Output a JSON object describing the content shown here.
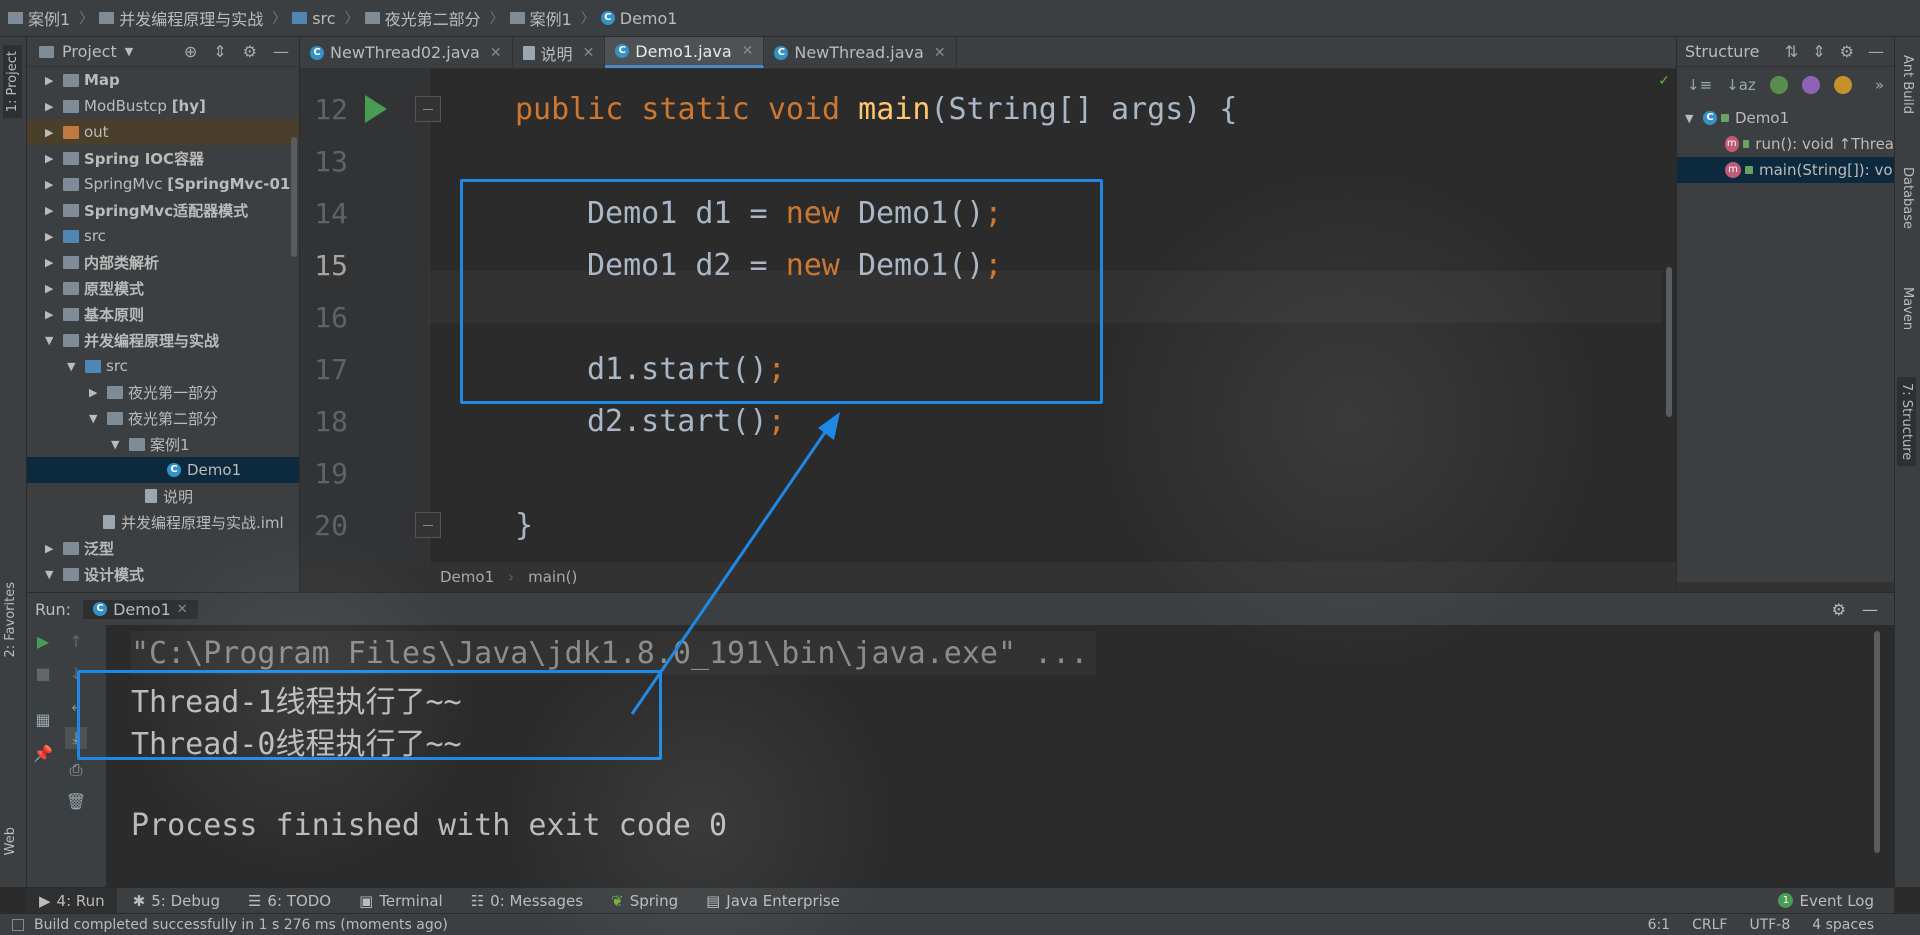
{
  "breadcrumb": [
    "案例1",
    "并发编程原理与实战",
    "src",
    "夜光第二部分",
    "案例1",
    "Demo1"
  ],
  "left_tabs": {
    "project": "1: Project",
    "favorites": "2: Favorites",
    "web": "Web"
  },
  "right_tabs": {
    "ant": "Ant Build",
    "database": "Database",
    "maven": "Maven",
    "structure": "7: Structure"
  },
  "project_panel": {
    "title": "Project",
    "tree": [
      {
        "label": "Map",
        "bold": true
      },
      {
        "label": "ModBustcp",
        "suffix": "[hy]"
      },
      {
        "label": "out"
      },
      {
        "label": "Spring IOC容器",
        "bold": true
      },
      {
        "label": "SpringMvc",
        "suffix": "[SpringMvc-01]"
      },
      {
        "label": "SpringMvc适配器模式",
        "bold": true
      },
      {
        "label": "src"
      },
      {
        "label": "内部类解析",
        "bold": true
      },
      {
        "label": "原型模式",
        "bold": true
      },
      {
        "label": "基本原则",
        "bold": true
      },
      {
        "label": "并发编程原理与实战",
        "bold": true
      },
      {
        "label": "src"
      },
      {
        "label": "夜光第一部分"
      },
      {
        "label": "夜光第二部分"
      },
      {
        "label": "案例1"
      },
      {
        "label": "Demo1"
      },
      {
        "label": "说明"
      },
      {
        "label": "并发编程原理与实战.iml"
      },
      {
        "label": "泛型",
        "bold": true
      },
      {
        "label": "设计模式",
        "bold": true
      }
    ]
  },
  "editor": {
    "tabs": [
      {
        "label": "NewThread02.java"
      },
      {
        "label": "说明"
      },
      {
        "label": "Demo1.java"
      },
      {
        "label": "NewThread.java"
      }
    ],
    "lines": [
      {
        "n": "12"
      },
      {
        "n": "13"
      },
      {
        "n": "14"
      },
      {
        "n": "15"
      },
      {
        "n": "16"
      },
      {
        "n": "17"
      },
      {
        "n": "18"
      },
      {
        "n": "19"
      },
      {
        "n": "20"
      }
    ],
    "code": {
      "l12_a": "public static void ",
      "l12_b": "main",
      "l12_c": "(String[] args) {",
      "l14_a": "Demo1 d1 = ",
      "l14_b": "new ",
      "l14_c": "Demo1()",
      "l14_d": ";",
      "l15_a": "Demo1 d2 = ",
      "l15_b": "new ",
      "l15_c": "Demo1()",
      "l15_d": ";",
      "l17_a": "d1.start()",
      "l17_b": ";",
      "l18_a": "d2.start()",
      "l18_b": ";",
      "l20": "}"
    },
    "crumb": [
      "Demo1",
      "main()"
    ]
  },
  "structure_panel": {
    "title": "Structure",
    "items": [
      "Demo1",
      "run(): void ↑Threa",
      "main(String[]): vo"
    ]
  },
  "run_panel": {
    "label": "Run:",
    "tab": "Demo1",
    "console": [
      "\"C:\\Program Files\\Java\\jdk1.8.0_191\\bin\\java.exe\" ...",
      "Thread-1线程执行了~~",
      "Thread-0线程执行了~~",
      "",
      "Process finished with exit code 0"
    ]
  },
  "toolbar": {
    "run": "4: Run",
    "debug": "5: Debug",
    "todo": "6: TODO",
    "terminal": "Terminal",
    "messages": "0: Messages",
    "spring": "Spring",
    "java_enterprise": "Java Enterprise",
    "event_log": "Event Log"
  },
  "status": {
    "message": "Build completed successfully in 1 s 276 ms (moments ago)",
    "position": "6:1",
    "line_sep": "CRLF",
    "encoding": "UTF-8",
    "indent": "4 spaces"
  }
}
